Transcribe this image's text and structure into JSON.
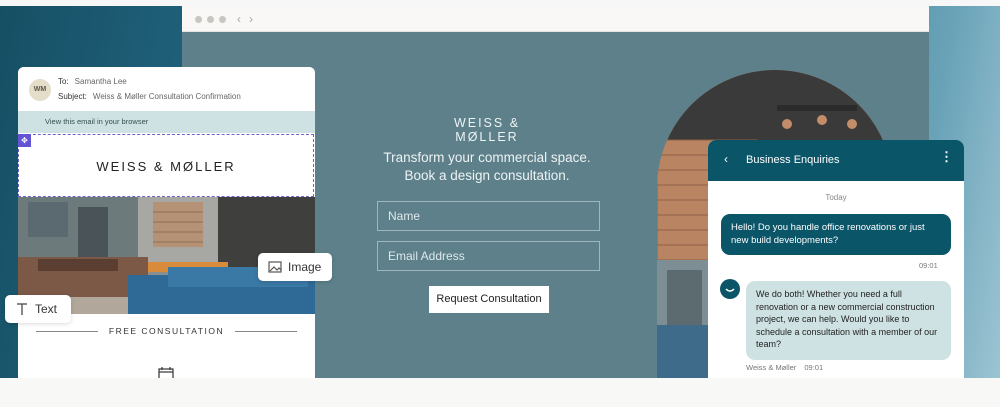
{
  "browser": {
    "nav_back": "‹",
    "nav_forward": "›"
  },
  "landing": {
    "logo": "WEISS & MØLLER",
    "headline_line1": "Transform your commercial space.",
    "headline_line2": "Book a design consultation.",
    "name_placeholder": "Name",
    "email_placeholder": "Email Address",
    "cta": "Request Consultation"
  },
  "email": {
    "avatar_initials": "WM",
    "to_label": "To:",
    "to_value": "Samantha Lee",
    "subject_label": "Subject:",
    "subject_value": "Weiss & Møller Consultation Confirmation",
    "view_in_browser": "View this email in your browser",
    "logo": "WEISS & MØLLER",
    "section_title": "FREE CONSULTATION"
  },
  "tooltips": {
    "image": "Image",
    "text": "Text"
  },
  "chat": {
    "back": "‹",
    "title": "Business Enquiries",
    "menu": "⋮",
    "day": "Today",
    "outgoing_text": "Hello! Do you handle office renovations or just new build developments?",
    "outgoing_time": "09:01",
    "incoming_text": "We do both! Whether you need a full renovation or a new commercial construction project, we can help. Would you like to schedule a consultation with a member of our team?",
    "incoming_sender": "Weiss & Møller",
    "incoming_time": "09:01"
  },
  "colors": {
    "brand_teal": "#0b5569",
    "landing_bg": "#5d808a",
    "bubble_light": "#cfe2e3",
    "selection_purple": "#6354d6"
  }
}
